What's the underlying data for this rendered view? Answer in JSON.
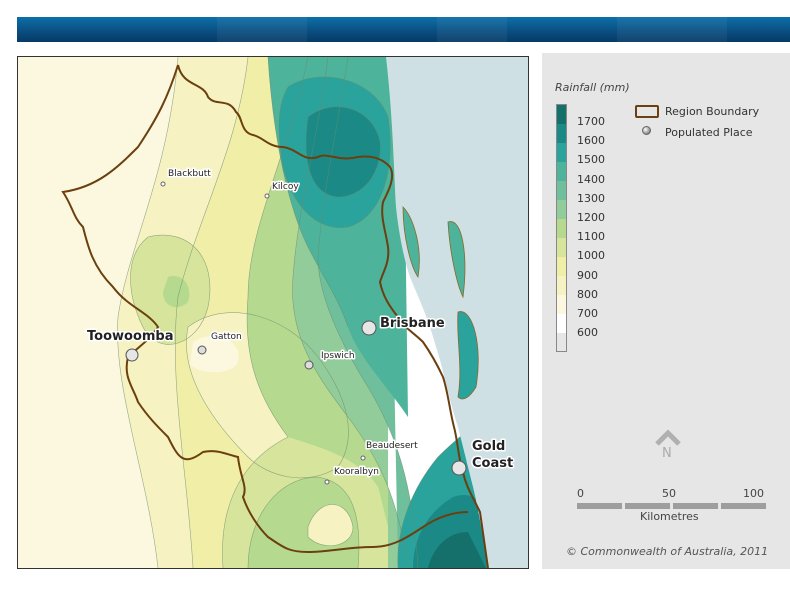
{
  "legend": {
    "title": "Rainfall (mm)",
    "ramp_colors": [
      "#15706c",
      "#1b8a86",
      "#2aa39c",
      "#4db39b",
      "#6fbf9c",
      "#92cc9a",
      "#b5d98f",
      "#d6e59b",
      "#f1eea7",
      "#f6f2c2",
      "#fbf8df",
      "#ffffff"
    ],
    "labels": [
      "1700",
      "1600",
      "1500",
      "1400",
      "1300",
      "1200",
      "1100",
      "1000",
      "900",
      "800",
      "700",
      "600"
    ],
    "boundary_label": "Region Boundary",
    "place_label": "Populated Place"
  },
  "map": {
    "ocean_color": "#cfe0e5",
    "boundary_color": "#6b3f0f",
    "places": [
      {
        "name": "Blackbutt",
        "type": "small"
      },
      {
        "name": "Kilcoy",
        "type": "small"
      },
      {
        "name": "Gatton",
        "type": "small"
      },
      {
        "name": "Ipswich",
        "type": "small"
      },
      {
        "name": "Beaudesert",
        "type": "small"
      },
      {
        "name": "Kooralbyn",
        "type": "small"
      },
      {
        "name": "Toowoomba",
        "type": "city"
      },
      {
        "name": "Brisbane",
        "type": "city"
      },
      {
        "name": "Gold",
        "type": "city"
      },
      {
        "name": "Coast",
        "type": "city"
      }
    ]
  },
  "north_label": "N",
  "scale": {
    "ticks": [
      "0",
      "50",
      "100"
    ],
    "unit": "Kilometres"
  },
  "credit": "© Commonwealth of Australia, 2011"
}
